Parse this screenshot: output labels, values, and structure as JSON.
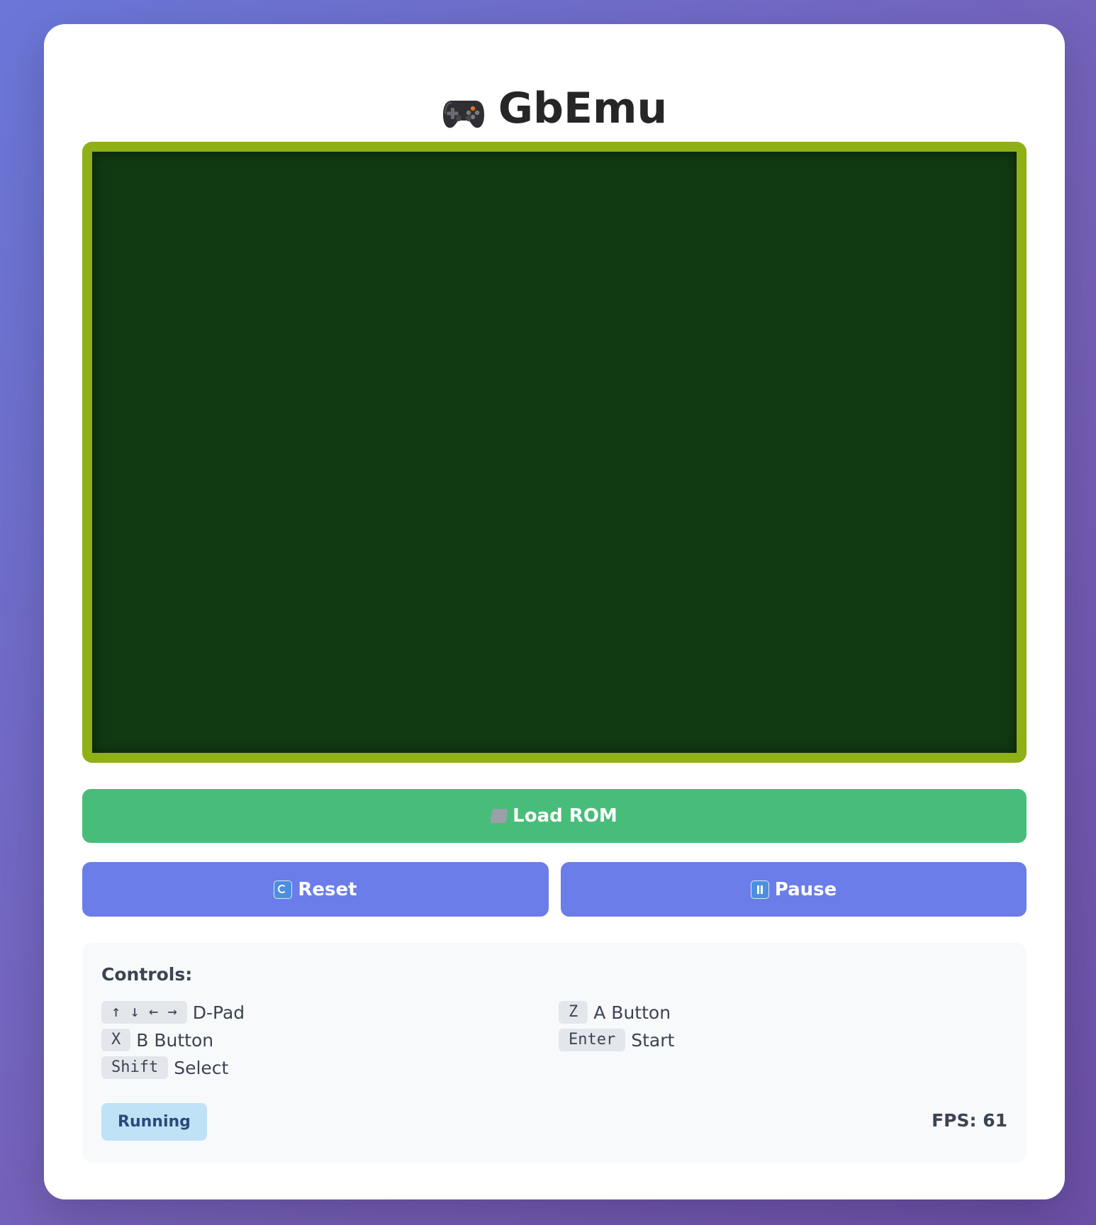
{
  "header": {
    "title": "GbEmu",
    "icon": "gamepad-icon"
  },
  "screen": {
    "frame_color": "#8fb016",
    "screen_color": "#113a12"
  },
  "buttons": {
    "load_rom": {
      "label": "Load ROM",
      "icon": "folder-icon",
      "color": "#48bd79"
    },
    "reset": {
      "label": "Reset",
      "icon": "reset-icon",
      "color": "#6a7de8"
    },
    "pause": {
      "label": "Pause",
      "icon": "pause-icon",
      "color": "#6a7de8"
    }
  },
  "controls": {
    "title": "Controls:",
    "items": [
      {
        "key": "↑ ↓ ← →",
        "action": "D-Pad"
      },
      {
        "key": "Z",
        "action": "A Button"
      },
      {
        "key": "X",
        "action": "B Button"
      },
      {
        "key": "Enter",
        "action": "Start"
      },
      {
        "key": "Shift",
        "action": "Select"
      }
    ]
  },
  "status": {
    "state": "Running",
    "fps_label": "FPS: 61"
  }
}
